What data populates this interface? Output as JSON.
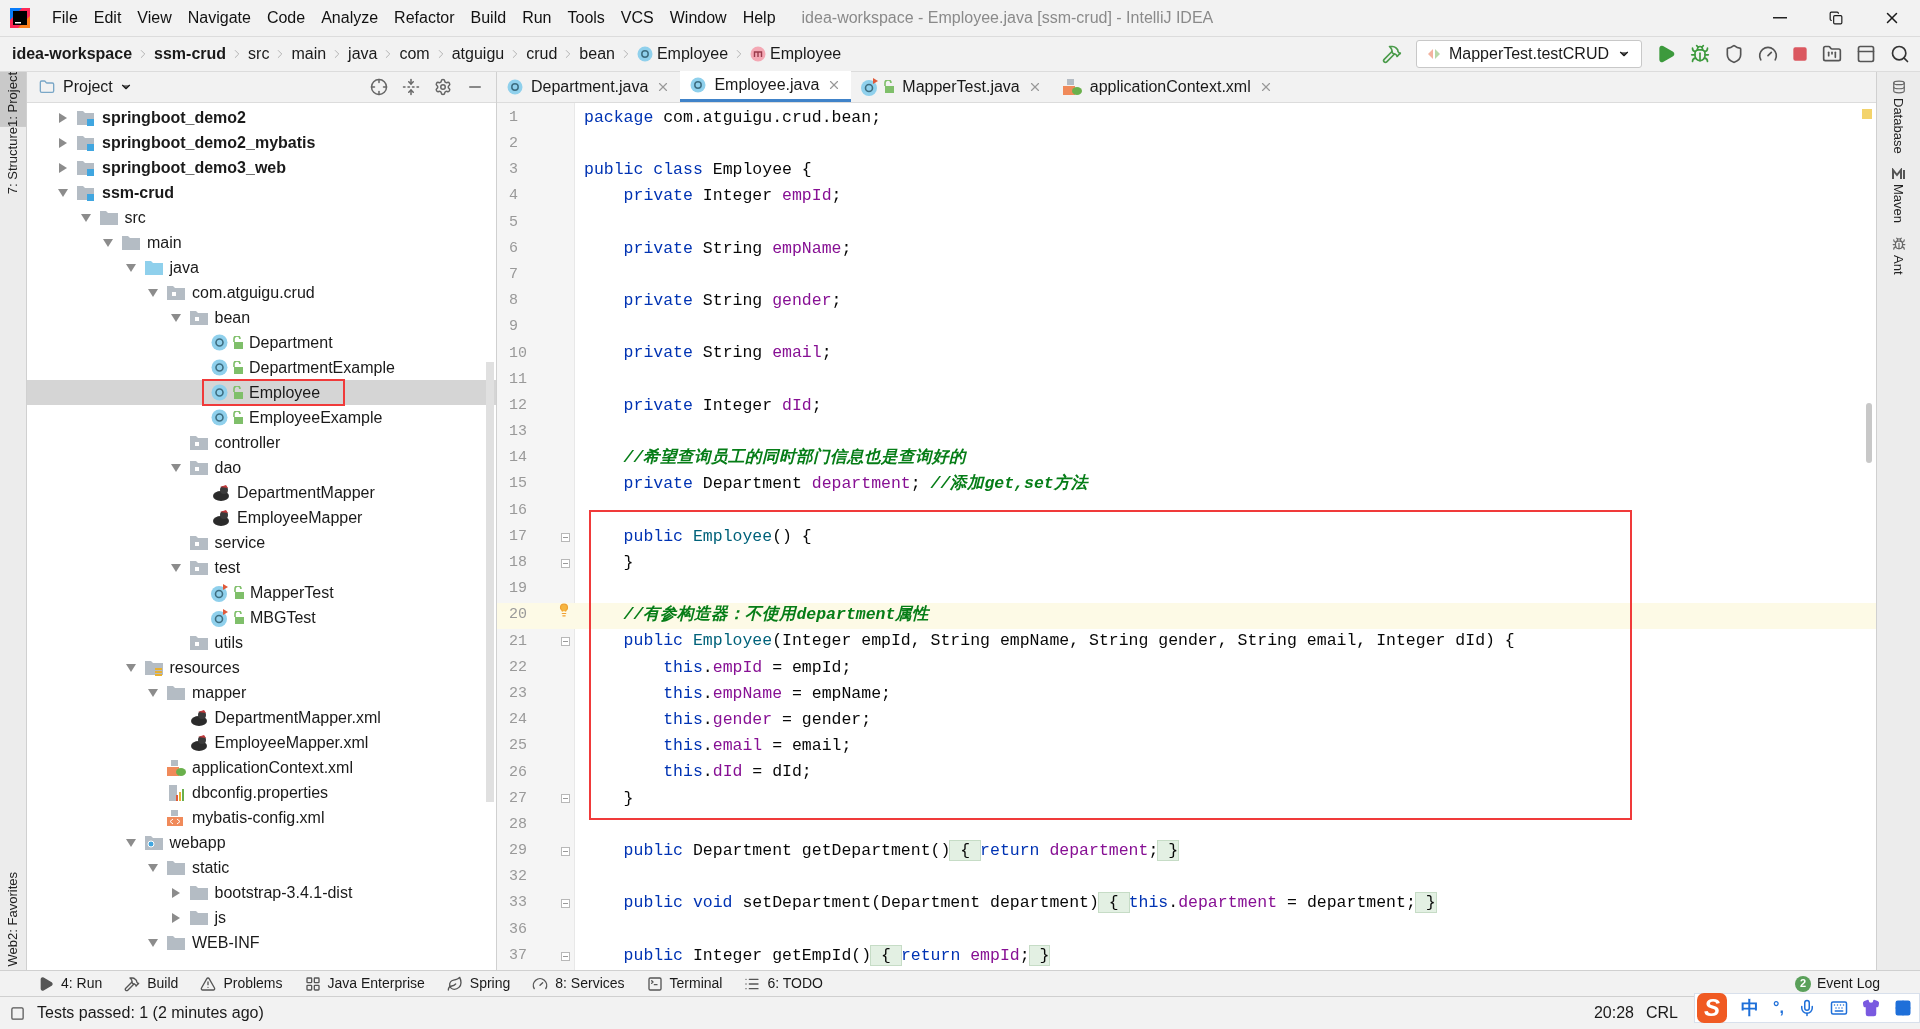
{
  "window": {
    "title": "idea-workspace - Employee.java [ssm-crud] - IntelliJ IDEA"
  },
  "menu": [
    "File",
    "Edit",
    "View",
    "Navigate",
    "Code",
    "Analyze",
    "Refactor",
    "Build",
    "Run",
    "Tools",
    "VCS",
    "Window",
    "Help"
  ],
  "breadcrumbs": [
    {
      "label": "idea-workspace",
      "kind": "project"
    },
    {
      "label": "ssm-crud",
      "kind": "project"
    },
    {
      "label": "src",
      "kind": "dir"
    },
    {
      "label": "main",
      "kind": "dir"
    },
    {
      "label": "java",
      "kind": "dir"
    },
    {
      "label": "com",
      "kind": "dir"
    },
    {
      "label": "atguigu",
      "kind": "dir"
    },
    {
      "label": "crud",
      "kind": "dir"
    },
    {
      "label": "bean",
      "kind": "dir"
    },
    {
      "label": "Employee",
      "kind": "class"
    },
    {
      "label": "Employee",
      "kind": "method"
    }
  ],
  "run_config": "MapperTest.testCRUD",
  "left_stripe_top": [
    {
      "label": "1: Project",
      "selected": true
    },
    {
      "label": "7: Structure",
      "selected": false
    }
  ],
  "left_stripe_bottom": [
    {
      "label": "2: Favorites",
      "selected": false
    },
    {
      "label": "Web",
      "selected": false
    }
  ],
  "right_stripe": [
    {
      "label": "Database",
      "kind": "database"
    },
    {
      "label": "Maven",
      "kind": "maven"
    },
    {
      "label": "Ant",
      "kind": "ant"
    }
  ],
  "project_panel": {
    "title": "Project",
    "tree": [
      {
        "label": "springboot_demo2",
        "kind": "module",
        "expanded": false,
        "selected": false
      },
      {
        "label": "springboot_demo2_mybatis",
        "kind": "module",
        "expanded": false,
        "selected": false
      },
      {
        "label": "springboot_demo3_web",
        "kind": "module",
        "expanded": false,
        "selected": false
      },
      {
        "label": "ssm-crud",
        "kind": "module",
        "expanded": true,
        "selected": false,
        "children": [
          {
            "label": "src",
            "kind": "folder",
            "expanded": true,
            "selected": false,
            "children": [
              {
                "label": "main",
                "kind": "folder",
                "expanded": true,
                "selected": false,
                "children": [
                  {
                    "label": "java",
                    "kind": "source",
                    "expanded": true,
                    "selected": false,
                    "children": [
                      {
                        "label": "com.atguigu.crud",
                        "kind": "package",
                        "expanded": true,
                        "selected": false,
                        "children": [
                          {
                            "label": "bean",
                            "kind": "package",
                            "expanded": true,
                            "selected": false,
                            "children": [
                              {
                                "label": "Department",
                                "kind": "class",
                                "selected": false
                              },
                              {
                                "label": "DepartmentExample",
                                "kind": "class",
                                "selected": false
                              },
                              {
                                "label": "Employee",
                                "kind": "class",
                                "selected": true,
                                "boxed": true
                              },
                              {
                                "label": "EmployeeExample",
                                "kind": "class",
                                "selected": false
                              }
                            ]
                          },
                          {
                            "label": "controller",
                            "kind": "package",
                            "selected": false
                          },
                          {
                            "label": "dao",
                            "kind": "package",
                            "expanded": true,
                            "selected": false,
                            "children": [
                              {
                                "label": "DepartmentMapper",
                                "kind": "mapper",
                                "selected": false
                              },
                              {
                                "label": "EmployeeMapper",
                                "kind": "mapper",
                                "selected": false
                              }
                            ]
                          },
                          {
                            "label": "service",
                            "kind": "package",
                            "selected": false
                          },
                          {
                            "label": "test",
                            "kind": "package",
                            "expanded": true,
                            "selected": false,
                            "children": [
                              {
                                "label": "MapperTest",
                                "kind": "test",
                                "selected": false
                              },
                              {
                                "label": "MBGTest",
                                "kind": "test",
                                "selected": false
                              }
                            ]
                          },
                          {
                            "label": "utils",
                            "kind": "package",
                            "selected": false
                          }
                        ]
                      }
                    ]
                  },
                  {
                    "label": "resources",
                    "kind": "resources",
                    "expanded": true,
                    "selected": false,
                    "children": [
                      {
                        "label": "mapper",
                        "kind": "folder",
                        "expanded": true,
                        "selected": false,
                        "children": [
                          {
                            "label": "DepartmentMapper.xml",
                            "kind": "mapper",
                            "selected": false
                          },
                          {
                            "label": "EmployeeMapper.xml",
                            "kind": "mapper",
                            "selected": false
                          }
                        ]
                      },
                      {
                        "label": "applicationContext.xml",
                        "kind": "spring",
                        "selected": false
                      },
                      {
                        "label": "dbconfig.properties",
                        "kind": "properties",
                        "selected": false
                      },
                      {
                        "label": "mybatis-config.xml",
                        "kind": "xml",
                        "selected": false
                      }
                    ]
                  },
                  {
                    "label": "webapp",
                    "kind": "web",
                    "expanded": true,
                    "selected": false,
                    "children": [
                      {
                        "label": "static",
                        "kind": "folder",
                        "expanded": true,
                        "selected": false,
                        "children": [
                          {
                            "label": "bootstrap-3.4.1-dist",
                            "kind": "folder",
                            "expanded": false,
                            "selected": false
                          },
                          {
                            "label": "js",
                            "kind": "folder",
                            "expanded": false,
                            "selected": false
                          }
                        ]
                      },
                      {
                        "label": "WEB-INF",
                        "kind": "folder",
                        "expanded": true,
                        "selected": false
                      }
                    ]
                  }
                ]
              }
            ]
          }
        ]
      }
    ]
  },
  "tabs": [
    {
      "label": "Department.java",
      "kind": "class",
      "selected": false
    },
    {
      "label": "Employee.java",
      "kind": "class",
      "selected": true
    },
    {
      "label": "MapperTest.java",
      "kind": "test",
      "selected": false
    },
    {
      "label": "applicationContext.xml",
      "kind": "spring",
      "selected": false
    }
  ],
  "code": [
    {
      "number": "1",
      "tokens": [
        {
          "text": "package ",
          "kind": "keyword"
        },
        {
          "text": "com.atguigu.crud.bean;",
          "kind": "plain"
        }
      ]
    },
    {
      "number": "2"
    },
    {
      "number": "3",
      "tokens": [
        {
          "text": "public class ",
          "kind": "keyword"
        },
        {
          "text": "Employee {",
          "kind": "plain"
        }
      ]
    },
    {
      "number": "4",
      "tokens": [
        {
          "text": "    private ",
          "kind": "keyword"
        },
        {
          "text": "Integer ",
          "kind": "plain"
        },
        {
          "text": "empId",
          "kind": "field"
        },
        {
          "text": ";",
          "kind": "plain"
        }
      ]
    },
    {
      "number": "5"
    },
    {
      "number": "6",
      "tokens": [
        {
          "text": "    private ",
          "kind": "keyword"
        },
        {
          "text": "String ",
          "kind": "plain"
        },
        {
          "text": "empName",
          "kind": "field"
        },
        {
          "text": ";",
          "kind": "plain"
        }
      ]
    },
    {
      "number": "7"
    },
    {
      "number": "8",
      "tokens": [
        {
          "text": "    private ",
          "kind": "keyword"
        },
        {
          "text": "String ",
          "kind": "plain"
        },
        {
          "text": "gender",
          "kind": "field"
        },
        {
          "text": ";",
          "kind": "plain"
        }
      ]
    },
    {
      "number": "9"
    },
    {
      "number": "10",
      "tokens": [
        {
          "text": "    private ",
          "kind": "keyword"
        },
        {
          "text": "String ",
          "kind": "plain"
        },
        {
          "text": "email",
          "kind": "field"
        },
        {
          "text": ";",
          "kind": "plain"
        }
      ]
    },
    {
      "number": "11"
    },
    {
      "number": "12",
      "tokens": [
        {
          "text": "    private ",
          "kind": "keyword"
        },
        {
          "text": "Integer ",
          "kind": "plain"
        },
        {
          "text": "dId",
          "kind": "field"
        },
        {
          "text": ";",
          "kind": "plain"
        }
      ]
    },
    {
      "number": "13"
    },
    {
      "number": "14",
      "tokens": [
        {
          "text": "    //希望查询员工的同时部门信息也是查询好的",
          "kind": "comment"
        }
      ]
    },
    {
      "number": "15",
      "tokens": [
        {
          "text": "    private ",
          "kind": "keyword"
        },
        {
          "text": "Department ",
          "kind": "plain"
        },
        {
          "text": "department",
          "kind": "field"
        },
        {
          "text": "; ",
          "kind": "plain"
        },
        {
          "text": "//添加get,set方法",
          "kind": "comment"
        }
      ]
    },
    {
      "number": "16"
    },
    {
      "number": "17",
      "fold": true,
      "boxed": true,
      "tokens": [
        {
          "text": "    public ",
          "kind": "keyword"
        },
        {
          "text": "Employee",
          "kind": "method"
        },
        {
          "text": "() {",
          "kind": "plain"
        }
      ]
    },
    {
      "number": "18",
      "fold": true,
      "boxed": true,
      "tokens": [
        {
          "text": "    }",
          "kind": "plain"
        }
      ]
    },
    {
      "number": "19",
      "boxed": true
    },
    {
      "number": "20",
      "boxed": true,
      "current": true,
      "tokens": [
        {
          "text": "    //有参构造器：不使用department属性",
          "kind": "comment"
        }
      ]
    },
    {
      "number": "21",
      "fold": true,
      "boxed": true,
      "tokens": [
        {
          "text": "    public ",
          "kind": "keyword"
        },
        {
          "text": "Employee",
          "kind": "method"
        },
        {
          "text": "(Integer empId, String empName, String gender, String email, Integer dId) {",
          "kind": "plain"
        }
      ]
    },
    {
      "number": "22",
      "boxed": true,
      "tokens": [
        {
          "text": "        this",
          "kind": "keyword"
        },
        {
          "text": ".",
          "kind": "plain"
        },
        {
          "text": "empId",
          "kind": "field"
        },
        {
          "text": " = empId;",
          "kind": "plain"
        }
      ]
    },
    {
      "number": "23",
      "boxed": true,
      "tokens": [
        {
          "text": "        this",
          "kind": "keyword"
        },
        {
          "text": ".",
          "kind": "plain"
        },
        {
          "text": "empName",
          "kind": "field"
        },
        {
          "text": " = empName;",
          "kind": "plain"
        }
      ]
    },
    {
      "number": "24",
      "boxed": true,
      "tokens": [
        {
          "text": "        this",
          "kind": "keyword"
        },
        {
          "text": ".",
          "kind": "plain"
        },
        {
          "text": "gender",
          "kind": "field"
        },
        {
          "text": " = gender;",
          "kind": "plain"
        }
      ]
    },
    {
      "number": "25",
      "boxed": true,
      "tokens": [
        {
          "text": "        this",
          "kind": "keyword"
        },
        {
          "text": ".",
          "kind": "plain"
        },
        {
          "text": "email",
          "kind": "field"
        },
        {
          "text": " = email;",
          "kind": "plain"
        }
      ]
    },
    {
      "number": "26",
      "boxed": true,
      "tokens": [
        {
          "text": "        this",
          "kind": "keyword"
        },
        {
          "text": ".",
          "kind": "plain"
        },
        {
          "text": "dId",
          "kind": "field"
        },
        {
          "text": " = dId;",
          "kind": "plain"
        }
      ]
    },
    {
      "number": "27",
      "fold": true,
      "boxed": true,
      "tokens": [
        {
          "text": "    }",
          "kind": "plain"
        }
      ]
    },
    {
      "number": "28"
    },
    {
      "number": "29",
      "fold": true,
      "tokens": [
        {
          "text": "    public ",
          "kind": "keyword"
        },
        {
          "text": "Department getDepartment()",
          "kind": "plain"
        },
        {
          "text": " { ",
          "kind": "folded"
        },
        {
          "text": "return ",
          "kind": "keyword"
        },
        {
          "text": "department",
          "kind": "field"
        },
        {
          "text": ";",
          "kind": "plain"
        },
        {
          "text": " }",
          "kind": "folded"
        }
      ]
    },
    {
      "number": "32"
    },
    {
      "number": "33",
      "fold": true,
      "tokens": [
        {
          "text": "    public void ",
          "kind": "keyword"
        },
        {
          "text": "setDepartment(Department department)",
          "kind": "plain"
        },
        {
          "text": " { ",
          "kind": "folded"
        },
        {
          "text": "this",
          "kind": "keyword"
        },
        {
          "text": ".",
          "kind": "plain"
        },
        {
          "text": "department",
          "kind": "field"
        },
        {
          "text": " = department;",
          "kind": "plain"
        },
        {
          "text": " }",
          "kind": "folded"
        }
      ]
    },
    {
      "number": "36"
    },
    {
      "number": "37",
      "fold": true,
      "tokens": [
        {
          "text": "    public ",
          "kind": "keyword"
        },
        {
          "text": "Integer getEmpId()",
          "kind": "plain"
        },
        {
          "text": " { ",
          "kind": "folded"
        },
        {
          "text": "return ",
          "kind": "keyword"
        },
        {
          "text": "empId",
          "kind": "field"
        },
        {
          "text": ";",
          "kind": "plain"
        },
        {
          "text": " }",
          "kind": "folded"
        }
      ]
    }
  ],
  "tool_windows": [
    {
      "label": "4: Run",
      "kind": "run"
    },
    {
      "label": "Build",
      "kind": "build"
    },
    {
      "label": "Problems",
      "kind": "problems"
    },
    {
      "label": "Java Enterprise",
      "kind": "enterprise"
    },
    {
      "label": "Spring",
      "kind": "spring"
    },
    {
      "label": "8: Services",
      "kind": "services"
    },
    {
      "label": "Terminal",
      "kind": "terminal"
    },
    {
      "label": "6: TODO",
      "kind": "todo"
    }
  ],
  "event_log": {
    "label": "Event Log",
    "count": "2"
  },
  "status_bar": {
    "message": "Tests passed: 1 (2 minutes ago)",
    "position": "20:28",
    "line_separator": "CRL"
  },
  "ime_toolbar": {
    "logo": "S",
    "mode": "中",
    "punctuation": "°,"
  }
}
